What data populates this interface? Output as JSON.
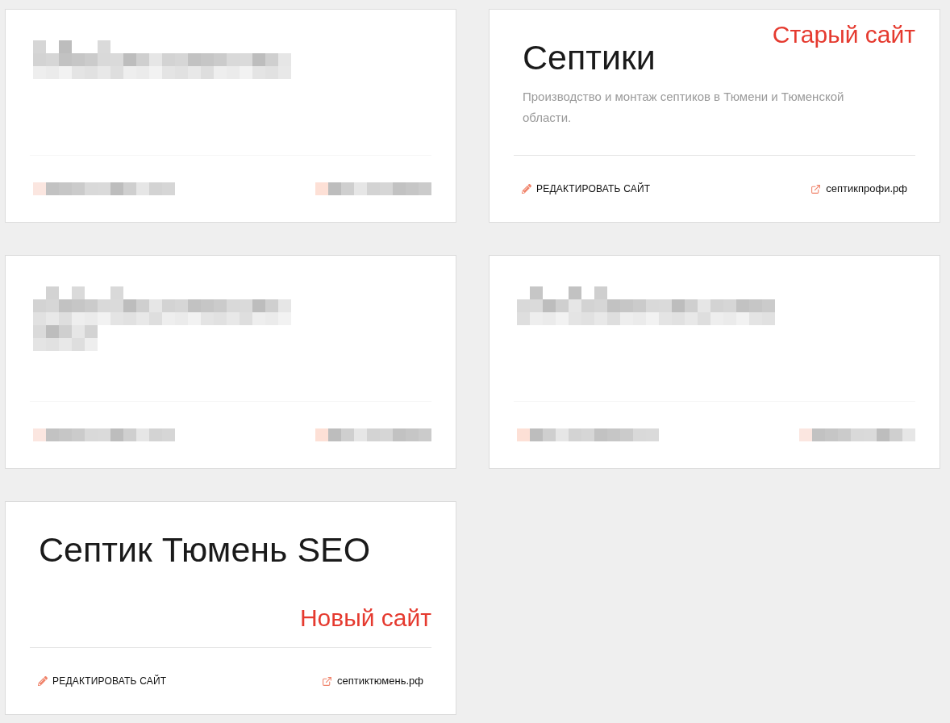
{
  "cards": [
    {
      "kind": "redacted",
      "blurred_lines": [
        {
          "kind": "long"
        }
      ]
    },
    {
      "kind": "site",
      "annotation": {
        "kind": "corner",
        "text": "Старый сайт"
      },
      "title": "Септики",
      "description": "Производство и монтаж септиков в Тюмени и Тюменской области.",
      "edit_link": "РЕДАКТИРОВАТЬ САЙТ",
      "site_link": "септикпрофи.рф"
    },
    {
      "kind": "redacted",
      "blurred_lines": [
        {
          "kind": "long"
        },
        {
          "kind": "short"
        }
      ]
    },
    {
      "kind": "redacted",
      "blurred_lines": [
        {
          "kind": "long"
        }
      ]
    },
    {
      "kind": "site",
      "title": "Септик Тюмень SEO",
      "annotation": {
        "kind": "above_divider",
        "text": "Новый сайт"
      },
      "edit_link": "РЕДАКТИРОВАТЬ САЙТ",
      "site_link": "септиктюмень.рф"
    }
  ]
}
